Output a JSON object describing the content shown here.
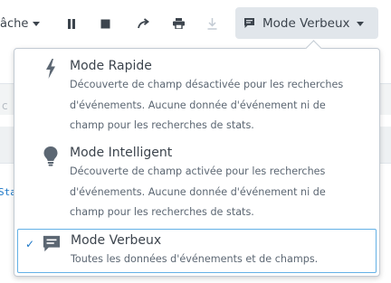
{
  "toolbar": {
    "job_menu_label": "âche",
    "pause_icon": "pause-icon",
    "stop_icon": "stop-icon",
    "share_icon": "share-icon",
    "print_icon": "print-icon",
    "export_icon": "download-icon",
    "mode_button_label": "Mode Verbeux",
    "mode_button_icon": "comment-icon"
  },
  "background": {
    "partial_link": "Sta",
    "partial_text": "c"
  },
  "search_modes": {
    "items": [
      {
        "icon": "lightning-bolt-icon",
        "title": "Mode Rapide",
        "description": "Découverte de champ désactivée pour les recherches d'événements. Aucune donnée d'événement ni de champ pour les recherches de stats.",
        "selected": false
      },
      {
        "icon": "lightbulb-icon",
        "title": "Mode Intelligent",
        "description": "Découverte de champ activée pour les recherches d'événements. Aucune donnée d'événement ni de champ pour les recherches de stats.",
        "selected": false
      },
      {
        "icon": "comment-icon",
        "title": "Mode Verbeux",
        "description": "Toutes les données d'événements et de champs.",
        "selected": true,
        "check": "✓"
      }
    ]
  },
  "colors": {
    "accent": "#1a76c6",
    "selected_border": "#63b1e6",
    "mode_button_bg": "#e1e6eb"
  }
}
